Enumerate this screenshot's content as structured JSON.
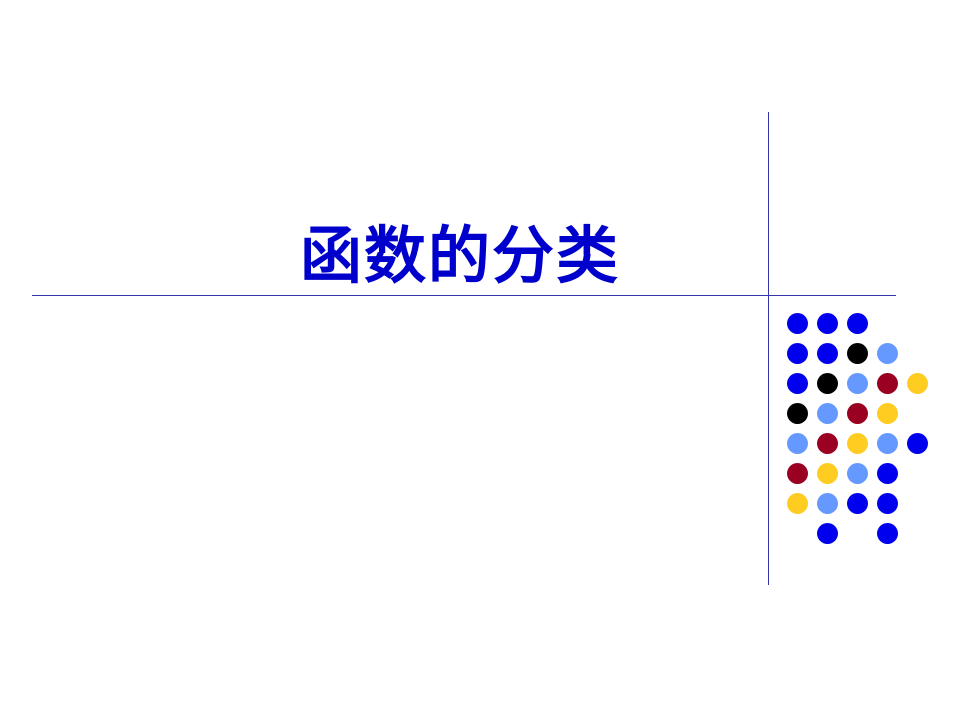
{
  "slide": {
    "title": "函数的分类"
  },
  "colors": {
    "title": "#0000cc",
    "rule": "#3333aa",
    "blue": "#0000ee",
    "light_blue": "#6699ff",
    "black": "#000000",
    "red": "#990022",
    "yellow": "#ffcc22"
  },
  "dot_grid": [
    [
      "blue",
      "blue",
      "blue",
      null,
      null
    ],
    [
      "blue",
      "blue",
      "black",
      "light_blue",
      null
    ],
    [
      "blue",
      "black",
      "light_blue",
      "red",
      "yellow"
    ],
    [
      "black",
      "light_blue",
      "red",
      "yellow",
      null
    ],
    [
      "light_blue",
      "red",
      "yellow",
      "light_blue",
      "blue"
    ],
    [
      "red",
      "yellow",
      "light_blue",
      "blue",
      null
    ],
    [
      "yellow",
      "light_blue",
      "blue",
      "blue",
      null
    ],
    [
      null,
      "blue",
      null,
      "blue",
      null
    ]
  ]
}
